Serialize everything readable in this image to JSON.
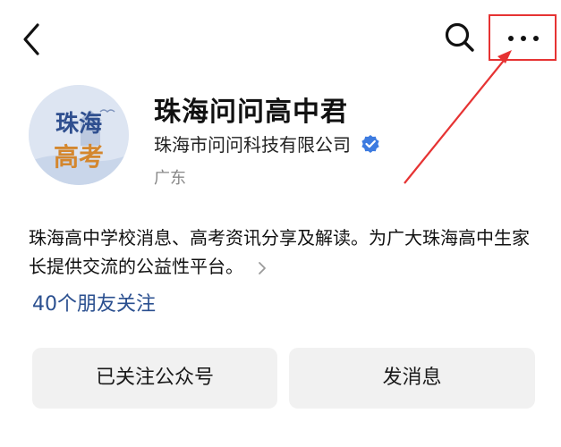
{
  "top_bar": {
    "icons": [
      "back-icon",
      "search-icon",
      "more-icon"
    ],
    "highlight_color": "#e63333"
  },
  "profile": {
    "avatar_text_line1": "珠海",
    "avatar_text_line2": "高考",
    "name": "珠海问问高中君",
    "company": "珠海市问问科技有限公司",
    "verified_color": "#3d7be0",
    "region": "广东"
  },
  "description": {
    "text": "珠海高中学校消息、高考资讯分享及解读。为广大珠海高中生家长提供交流的公益性平台。"
  },
  "friends": {
    "label": "40个朋友关注",
    "color": "#2a4f8f"
  },
  "actions": {
    "follow_label": "已关注公众号",
    "message_label": "发消息"
  }
}
